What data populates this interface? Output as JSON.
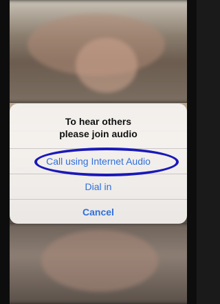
{
  "alert": {
    "title_line1": "To hear others",
    "title_line2": "please join audio",
    "actions": [
      {
        "label": "Call using Internet Audio"
      },
      {
        "label": "Dial in"
      },
      {
        "label": "Cancel"
      }
    ]
  },
  "colors": {
    "action_text": "#2f6fdc",
    "highlight_ring": "#1a19b8"
  }
}
